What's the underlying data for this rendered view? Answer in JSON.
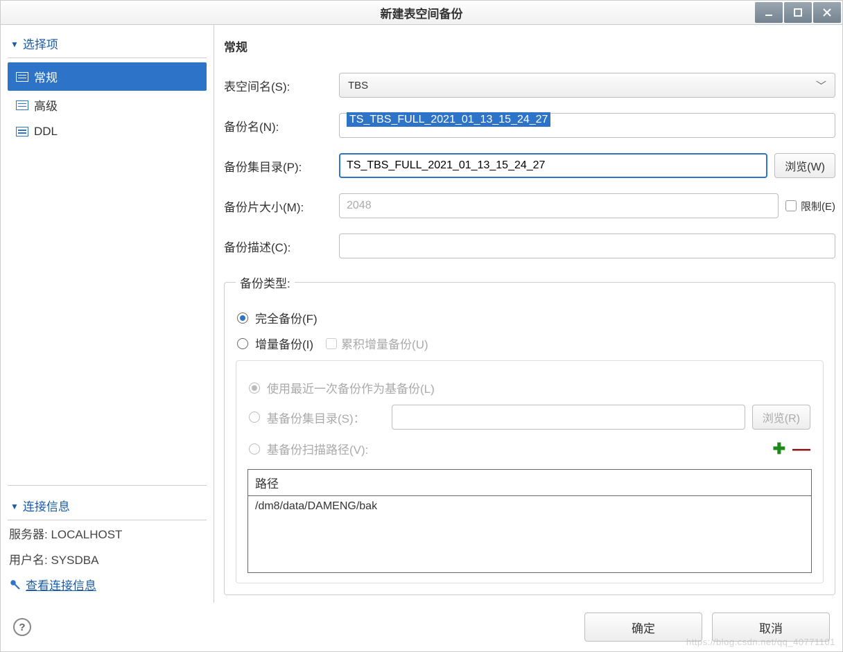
{
  "window": {
    "title": "新建表空间备份"
  },
  "sidebar": {
    "section_label": "选择项",
    "items": [
      {
        "label": "常规",
        "selected": true
      },
      {
        "label": "高级",
        "selected": false
      },
      {
        "label": "DDL",
        "selected": false
      }
    ],
    "connection": {
      "section_label": "连接信息",
      "server_label": "服务器:",
      "server_value": "LOCALHOST",
      "user_label": "用户名:",
      "user_value": "SYSDBA",
      "view_link": "查看连接信息"
    }
  },
  "main": {
    "heading": "常规",
    "tablespace_label": "表空间名(S):",
    "tablespace_value": "TBS",
    "backup_name_label": "备份名(N):",
    "backup_name_value": "TS_TBS_FULL_2021_01_13_15_24_27",
    "backup_dir_label": "备份集目录(P):",
    "backup_dir_value": "TS_TBS_FULL_2021_01_13_15_24_27",
    "browse_w_label": "浏览(W)",
    "piece_size_label": "备份片大小(M):",
    "piece_size_value": "2048",
    "limit_label": "限制(E)",
    "desc_label": "备份描述(C):",
    "desc_value": "",
    "group_label": "备份类型:",
    "full_label": "完全备份(F)",
    "incr_label": "增量备份(I)",
    "cumulative_label": "累积增量备份(U)",
    "use_latest_label": "使用最近一次备份作为基备份(L)",
    "base_dir_label": "基备份集目录(S)：",
    "base_dir_value": "",
    "browse_r_label": "浏览(R)",
    "scan_label": "基备份扫描路径(V):",
    "path_header": "路径",
    "path_value": "/dm8/data/DAMENG/bak"
  },
  "footer": {
    "ok_label": "确定",
    "cancel_label": "取消"
  },
  "watermark": "https://blog.csdn.net/qq_40771101"
}
